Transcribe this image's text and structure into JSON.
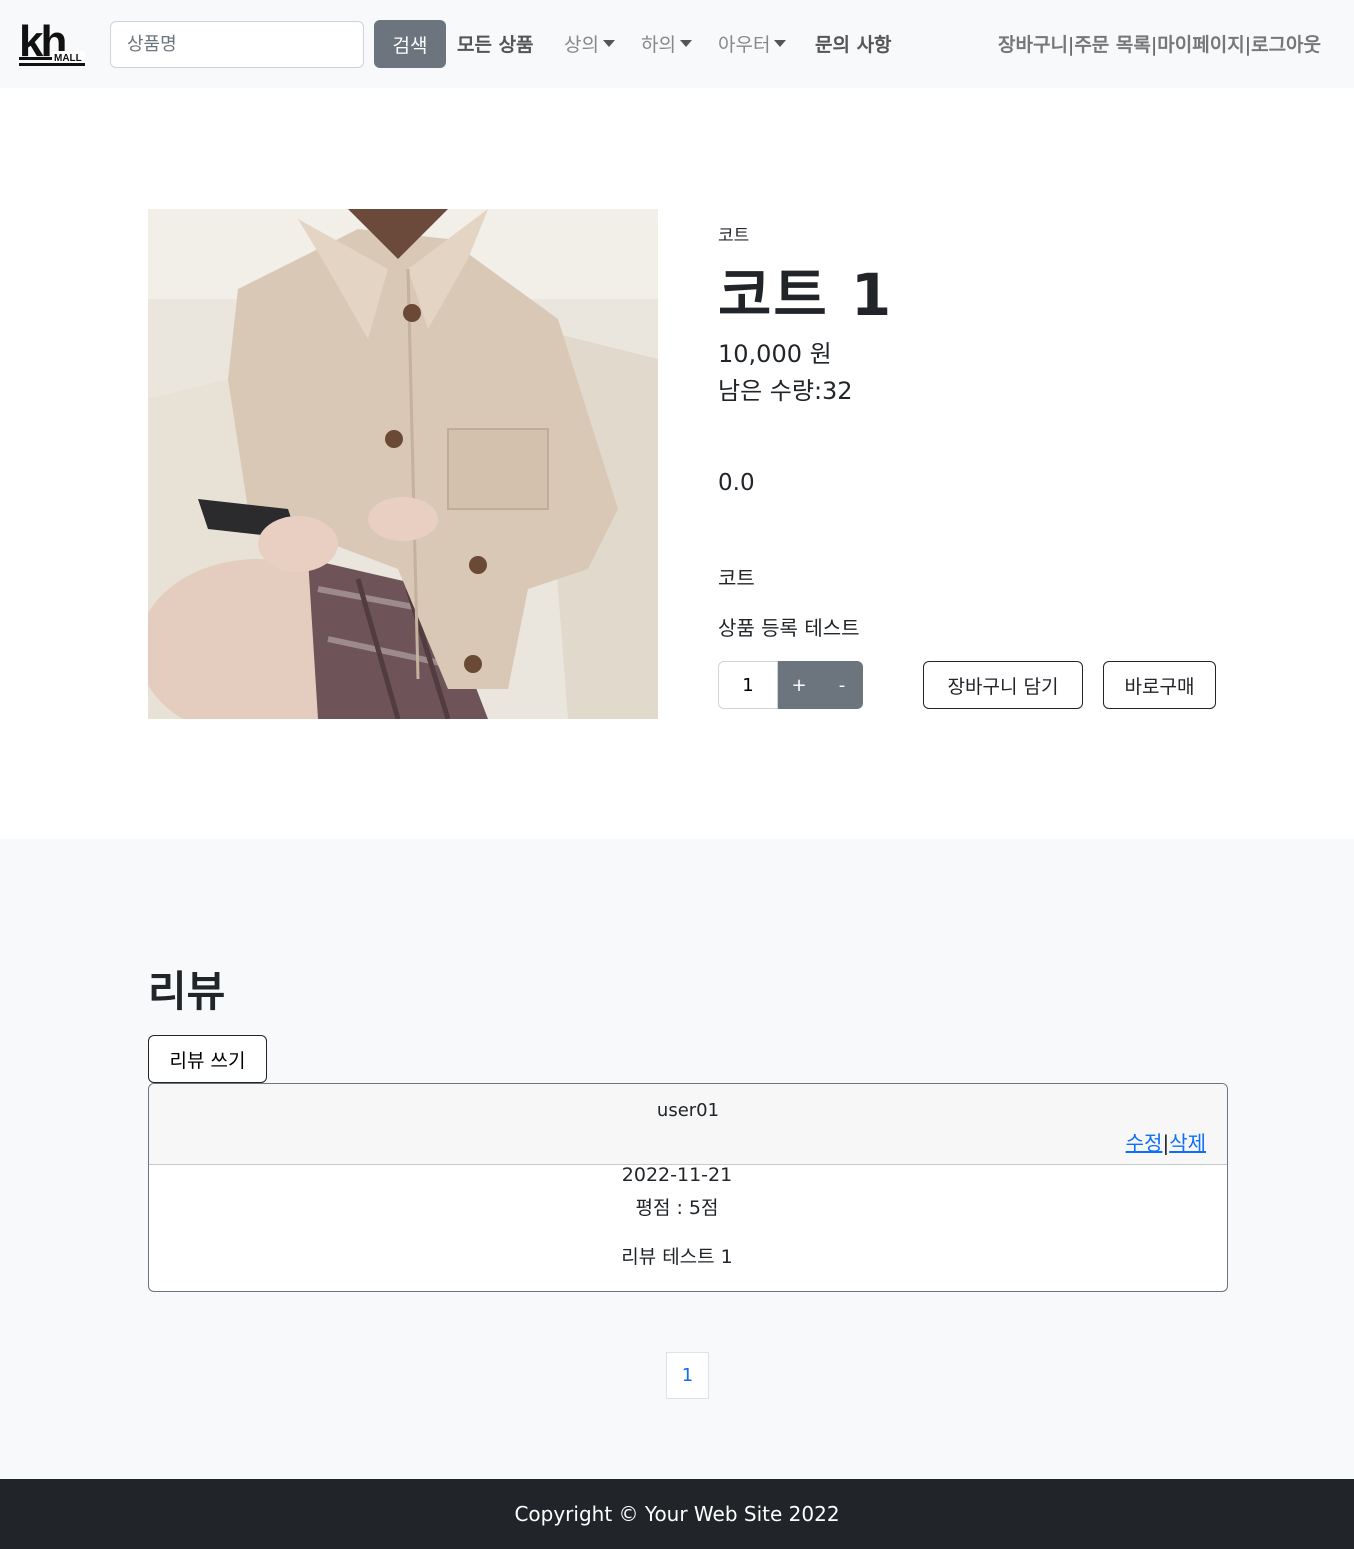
{
  "nav": {
    "logo_text": "kh",
    "logo_subtext": "MALL",
    "search_placeholder": "상품명",
    "search_button": "검색",
    "all_products": "모든 상품",
    "menu_tops": "상의",
    "menu_bottoms": "하의",
    "menu_outer": "아우터",
    "inquiry": "문의 사항",
    "cart": "장바구니",
    "orders": "주문 목록",
    "mypage": "마이페이지",
    "logout": "로그아웃",
    "separator": "|"
  },
  "product": {
    "category": "코트",
    "title": "코트 1",
    "price": "10,000 원",
    "stock": "남은 수량:32",
    "rating": "0.0",
    "category_label": "코트",
    "description": "상품 등록 테스트",
    "quantity": "1",
    "plus": "+",
    "minus": "-",
    "add_to_cart": "장바구니 담기",
    "buy_now": "바로구매"
  },
  "reviews": {
    "title": "리뷰",
    "write_button": "리뷰 쓰기",
    "items": [
      {
        "user": "user01",
        "edit": "수정",
        "delete": "삭제",
        "separator": "|",
        "date": "2022-11-21",
        "score": "평점 : 5점",
        "content": "리뷰 테스트 1"
      }
    ],
    "pages": [
      "1"
    ]
  },
  "footer": {
    "copyright": "Copyright © Your Web Site 2022"
  }
}
